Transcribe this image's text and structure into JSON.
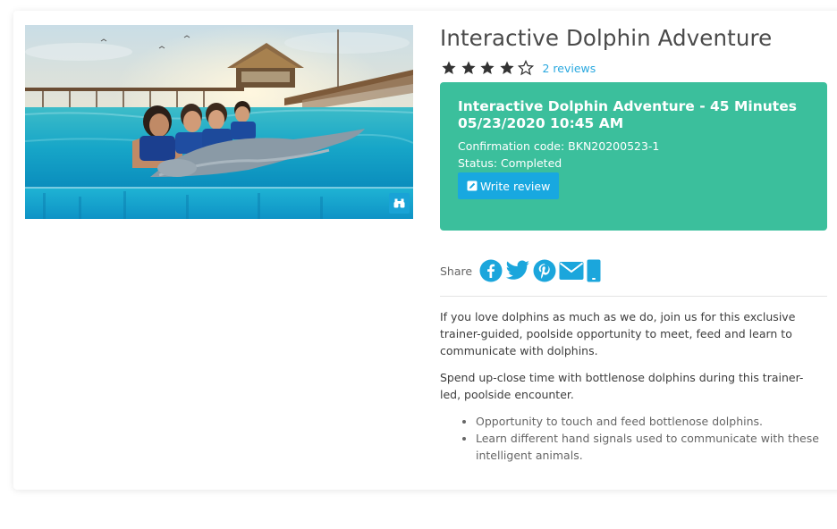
{
  "activity": {
    "title": "Interactive Dolphin Adventure",
    "rating": 4,
    "rating_max": 5,
    "reviews_label": "2 reviews"
  },
  "booking": {
    "title": "Interactive Dolphin Adventure - 45 Minutes",
    "datetime": "05/23/2020 10:45 AM",
    "confirmation": "Confirmation code: BKN20200523-1",
    "status": "Status: Completed",
    "write_review_label": "Write review",
    "background_color": "#3bbf9c",
    "button_color": "#18a8e0"
  },
  "share": {
    "label": "Share",
    "icons": [
      "facebook-icon",
      "twitter-icon",
      "pinterest-icon",
      "email-icon",
      "mobile-icon"
    ],
    "icon_color": "#1ba6dc"
  },
  "description": {
    "paragraphs": [
      "If you love dolphins as much as we do, join us for this exclusive trainer-guided, poolside opportunity to meet, feed and learn to communicate with dolphins.",
      "Spend up-close time with bottlenose dolphins during this trainer-led, poolside encounter."
    ],
    "bullets": [
      "Opportunity to touch and feed bottlenose dolphins.",
      "Learn different hand signals used to communicate with these intelligent animals."
    ]
  },
  "photo": {
    "icon": "binoculars-icon"
  }
}
